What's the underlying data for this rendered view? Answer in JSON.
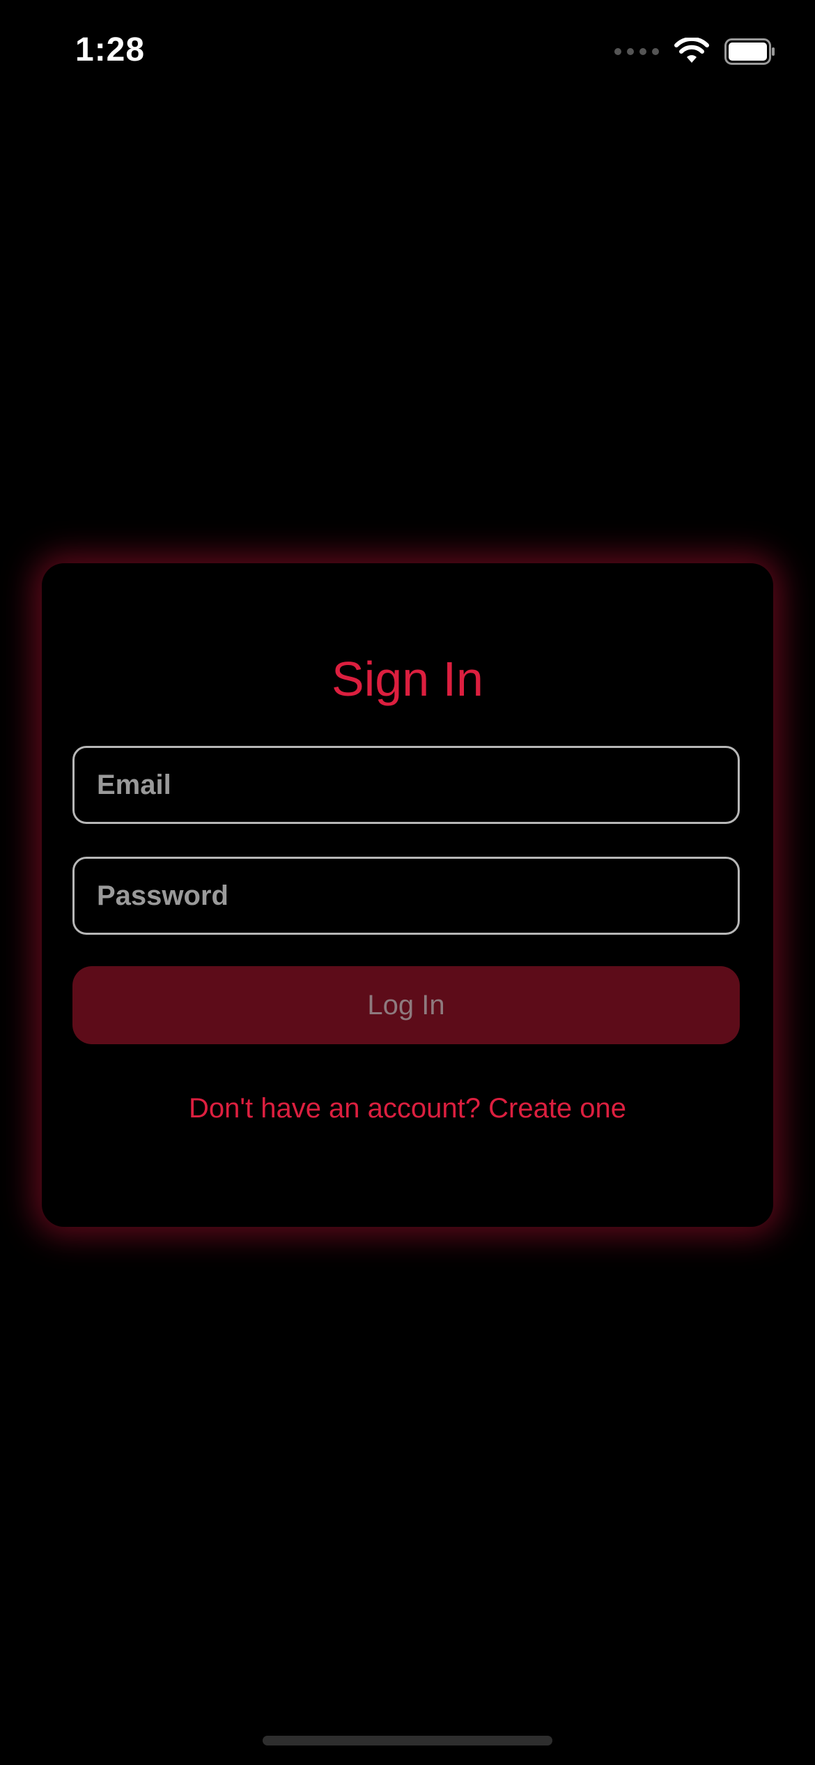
{
  "status_bar": {
    "time": "1:28",
    "icons": [
      "cellular-signal-icon",
      "wifi-icon",
      "battery-icon"
    ]
  },
  "card": {
    "title": "Sign In",
    "email_placeholder": "Email",
    "password_placeholder": "Password",
    "login_label": "Log In",
    "create_account_link": "Don't have an account? Create one"
  },
  "colors": {
    "background": "#000000",
    "accent": "#dc1f3f",
    "button_background": "#5d0c19",
    "field_border": "#b7b7b7",
    "placeholder": "#9a9a9a",
    "card_glow": "#6e0a1e"
  }
}
